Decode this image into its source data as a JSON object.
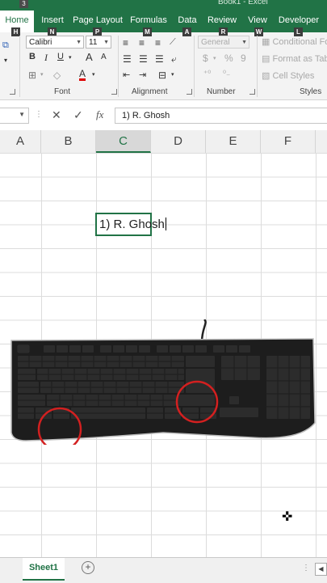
{
  "title": {
    "qat_badge": "3",
    "window_title": "Book1 - Excel"
  },
  "tabs": [
    {
      "label": "Home",
      "keytip": "H",
      "active": true
    },
    {
      "label": "Insert",
      "keytip": "N"
    },
    {
      "label": "Page Layout",
      "keytip": "P"
    },
    {
      "label": "Formulas",
      "keytip": "M"
    },
    {
      "label": "Data",
      "keytip": "A"
    },
    {
      "label": "Review",
      "keytip": "R"
    },
    {
      "label": "View",
      "keytip": "W"
    },
    {
      "label": "Developer",
      "keytip": "L"
    }
  ],
  "ribbon": {
    "font_name": "Calibri",
    "font_size": "11",
    "bold": "B",
    "italic": "I",
    "underline": "U",
    "grow_font": "A",
    "shrink_font": "A",
    "font_color": "A",
    "number_format": "General",
    "currency": "$",
    "percent": "%",
    "comma": "9",
    "conditional_formatting": "Conditional Form",
    "format_as_table": "Format as Table",
    "cell_styles": "Cell Styles",
    "groups": {
      "font": "Font",
      "alignment": "Alignment",
      "number": "Number",
      "styles": "Styles"
    }
  },
  "formula_bar": {
    "cancel": "✕",
    "enter": "✓",
    "fx": "fx",
    "value": "1) R. Ghosh"
  },
  "columns": [
    "A",
    "B",
    "C",
    "D",
    "E",
    "F"
  ],
  "active_column": "C",
  "cell": {
    "value": "1) R. Ghosh"
  },
  "sheets": {
    "active": "Sheet1",
    "add": "+"
  },
  "colors": {
    "excel_green": "#217346",
    "highlight_circle": "#d32020"
  }
}
